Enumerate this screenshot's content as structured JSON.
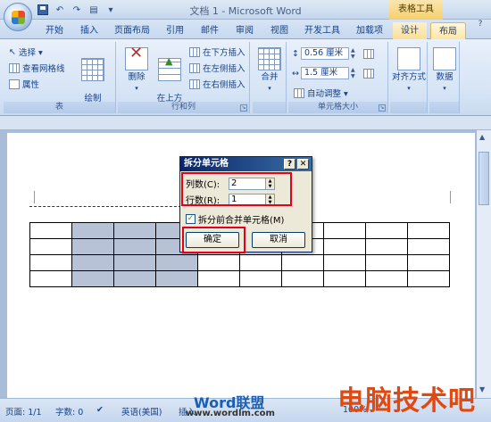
{
  "window": {
    "title": "文档 1 - Microsoft Word",
    "context_tab_title": "表格工具"
  },
  "tabs": [
    {
      "label": "开始"
    },
    {
      "label": "插入"
    },
    {
      "label": "页面布局"
    },
    {
      "label": "引用"
    },
    {
      "label": "邮件"
    },
    {
      "label": "审阅"
    },
    {
      "label": "视图"
    },
    {
      "label": "开发工具"
    },
    {
      "label": "加载项"
    },
    {
      "label": "设计"
    },
    {
      "label": "布局"
    }
  ],
  "ribbon": {
    "table_group": {
      "select": "选择 ▾",
      "view_gridlines": "查看网格线",
      "properties": "属性",
      "draw_diagonal": "绘制\n斜线表头",
      "label": "表"
    },
    "rows_cols_group": {
      "delete": "删除",
      "insert_above": "在上方\n插入",
      "insert_below": "在下方插入",
      "insert_left": "在左侧插入",
      "insert_right": "在右侧插入",
      "label": "行和列"
    },
    "merge_group": {
      "merge": "合并"
    },
    "cell_size_group": {
      "height_value": "0.56 厘米",
      "width_value": "1.5 厘米",
      "autofit": "自动调整 ▾",
      "label": "单元格大小"
    },
    "alignment": "对齐方式",
    "data": "数据"
  },
  "dialog": {
    "title": "拆分单元格",
    "help": "?",
    "close": "✕",
    "columns_label": "列数(C):",
    "columns_value": "2",
    "rows_label": "行数(R):",
    "rows_value": "1",
    "merge_before_split_label": "拆分前合并单元格(M)",
    "merge_before_split_checked": true,
    "ok": "确定",
    "cancel": "取消"
  },
  "statusbar": {
    "page": "页面: 1/1",
    "words": "字数: 0",
    "language": "英语(美国)",
    "mode": "插入",
    "zoom": "100%"
  },
  "watermark": {
    "brand": "Word联盟",
    "url": "www.wordlm.com",
    "site": "电脑技术吧"
  },
  "colors": {
    "highlight_red": "#e4001b",
    "selected_cells": "#b8c2d6",
    "dialog_title": "#0a246a"
  }
}
